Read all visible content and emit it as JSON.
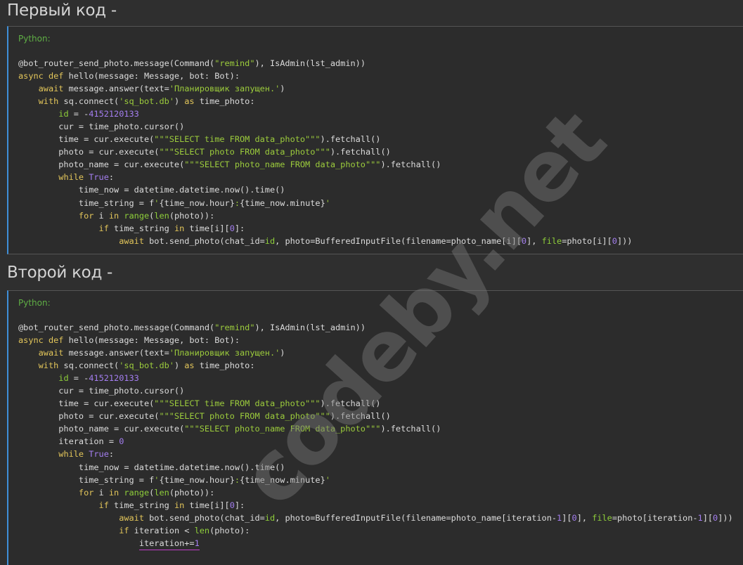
{
  "sections": [
    {
      "heading": "Первый код -",
      "language_label": "Python:",
      "code_lines": [
        [
          [
            "p",
            "@bot_router_send_photo.message(Command("
          ],
          [
            "str",
            "\"remind\""
          ],
          [
            "p",
            "), IsAdmin(lst_admin))"
          ]
        ],
        [
          [
            "kw",
            "async def "
          ],
          [
            "p",
            "hello(message: Message, bot: Bot):"
          ]
        ],
        [
          [
            "p",
            "    "
          ],
          [
            "kw",
            "await "
          ],
          [
            "p",
            "message.answer(text="
          ],
          [
            "str",
            "'Планировщик запущен.'"
          ],
          [
            "p",
            ")"
          ]
        ],
        [
          [
            "p",
            "    "
          ],
          [
            "kw",
            "with "
          ],
          [
            "p",
            "sq.connect("
          ],
          [
            "str",
            "'sq_bot.db'"
          ],
          [
            "p",
            ") "
          ],
          [
            "kw",
            "as "
          ],
          [
            "p",
            "time_photo:"
          ]
        ],
        [
          [
            "p",
            "        "
          ],
          [
            "bi",
            "id"
          ],
          [
            "p",
            " = -"
          ],
          [
            "num",
            "4152120133"
          ]
        ],
        [
          [
            "p",
            "        cur = time_photo.cursor()"
          ]
        ],
        [
          [
            "p",
            "        time = cur.execute("
          ],
          [
            "str",
            "\"\"\"SELECT time FROM data_photo\"\"\""
          ],
          [
            "p",
            ").fetchall()"
          ]
        ],
        [
          [
            "p",
            "        photo = cur.execute("
          ],
          [
            "str",
            "\"\"\"SELECT photo FROM data_photo\"\"\""
          ],
          [
            "p",
            ").fetchall()"
          ]
        ],
        [
          [
            "p",
            "        photo_name = cur.execute("
          ],
          [
            "str",
            "\"\"\"SELECT photo_name FROM data_photo\"\"\""
          ],
          [
            "p",
            ").fetchall()"
          ]
        ],
        [
          [
            "p",
            "        "
          ],
          [
            "kw",
            "while "
          ],
          [
            "num",
            "True"
          ],
          [
            "p",
            ":"
          ]
        ],
        [
          [
            "p",
            "            time_now = datetime.datetime.now().time()"
          ]
        ],
        [
          [
            "p",
            "            time_string = f"
          ],
          [
            "str",
            "'"
          ],
          [
            "p",
            "{time_now.hour}"
          ],
          [
            "str",
            ":"
          ],
          [
            "p",
            "{time_now.minute}"
          ],
          [
            "str",
            "'"
          ]
        ],
        [
          [
            "p",
            "            "
          ],
          [
            "kw",
            "for "
          ],
          [
            "p",
            "i "
          ],
          [
            "kw",
            "in "
          ],
          [
            "bi",
            "range"
          ],
          [
            "p",
            "("
          ],
          [
            "bi",
            "len"
          ],
          [
            "p",
            "(photo)):"
          ]
        ],
        [
          [
            "p",
            "                "
          ],
          [
            "kw",
            "if "
          ],
          [
            "p",
            "time_string "
          ],
          [
            "kw",
            "in "
          ],
          [
            "p",
            "time[i]["
          ],
          [
            "num",
            "0"
          ],
          [
            "p",
            "]:"
          ]
        ],
        [
          [
            "p",
            "                    "
          ],
          [
            "kw",
            "await "
          ],
          [
            "p",
            "bot.send_photo(chat_id="
          ],
          [
            "bi",
            "id"
          ],
          [
            "p",
            ", photo=BufferedInputFile(filename=photo_name[i]["
          ],
          [
            "num",
            "0"
          ],
          [
            "p",
            "], "
          ],
          [
            "bi",
            "file"
          ],
          [
            "p",
            "=photo[i]["
          ],
          [
            "num",
            "0"
          ],
          [
            "p",
            "]))"
          ]
        ]
      ]
    },
    {
      "heading": "Второй код -",
      "language_label": "Python:",
      "code_lines": [
        [
          [
            "p",
            "@bot_router_send_photo.message(Command("
          ],
          [
            "str",
            "\"remind\""
          ],
          [
            "p",
            "), IsAdmin(lst_admin))"
          ]
        ],
        [
          [
            "kw",
            "async def "
          ],
          [
            "p",
            "hello(message: Message, bot: Bot):"
          ]
        ],
        [
          [
            "p",
            "    "
          ],
          [
            "kw",
            "await "
          ],
          [
            "p",
            "message.answer(text="
          ],
          [
            "str",
            "'Планировщик запущен.'"
          ],
          [
            "p",
            ")"
          ]
        ],
        [
          [
            "p",
            "    "
          ],
          [
            "kw",
            "with "
          ],
          [
            "p",
            "sq.connect("
          ],
          [
            "str",
            "'sq_bot.db'"
          ],
          [
            "p",
            ") "
          ],
          [
            "kw",
            "as "
          ],
          [
            "p",
            "time_photo:"
          ]
        ],
        [
          [
            "p",
            "        "
          ],
          [
            "bi",
            "id"
          ],
          [
            "p",
            " = -"
          ],
          [
            "num",
            "4152120133"
          ]
        ],
        [
          [
            "p",
            "        cur = time_photo.cursor()"
          ]
        ],
        [
          [
            "p",
            "        time = cur.execute("
          ],
          [
            "str",
            "\"\"\"SELECT time FROM data_photo\"\"\""
          ],
          [
            "p",
            ").fetchall()"
          ]
        ],
        [
          [
            "p",
            "        photo = cur.execute("
          ],
          [
            "str",
            "\"\"\"SELECT photo FROM data_photo\"\"\""
          ],
          [
            "p",
            ").fetchall()"
          ]
        ],
        [
          [
            "p",
            "        photo_name = cur.execute("
          ],
          [
            "str",
            "\"\"\"SELECT photo_name FROM data_photo\"\"\""
          ],
          [
            "p",
            ").fetchall()"
          ]
        ],
        [
          [
            "p",
            "        iteration = "
          ],
          [
            "num",
            "0"
          ]
        ],
        [
          [
            "p",
            "        "
          ],
          [
            "kw",
            "while "
          ],
          [
            "num",
            "True"
          ],
          [
            "p",
            ":"
          ]
        ],
        [
          [
            "p",
            "            time_now = datetime.datetime.now().time()"
          ]
        ],
        [
          [
            "p",
            "            time_string = f"
          ],
          [
            "str",
            "'"
          ],
          [
            "p",
            "{time_now.hour}"
          ],
          [
            "str",
            ":"
          ],
          [
            "p",
            "{time_now.minute}"
          ],
          [
            "str",
            "'"
          ]
        ],
        [
          [
            "p",
            "            "
          ],
          [
            "kw",
            "for "
          ],
          [
            "p",
            "i "
          ],
          [
            "kw",
            "in "
          ],
          [
            "bi",
            "range"
          ],
          [
            "p",
            "("
          ],
          [
            "bi",
            "len"
          ],
          [
            "p",
            "(photo)):"
          ]
        ],
        [
          [
            "p",
            "                "
          ],
          [
            "kw",
            "if "
          ],
          [
            "p",
            "time_string "
          ],
          [
            "kw",
            "in "
          ],
          [
            "p",
            "time[i]["
          ],
          [
            "num",
            "0"
          ],
          [
            "p",
            "]:"
          ]
        ],
        [
          [
            "p",
            "                    "
          ],
          [
            "kw",
            "await "
          ],
          [
            "p",
            "bot.send_photo(chat_id="
          ],
          [
            "bi",
            "id"
          ],
          [
            "p",
            ", photo=BufferedInputFile(filename=photo_name[iteration-"
          ],
          [
            "num",
            "1"
          ],
          [
            "p",
            "]["
          ],
          [
            "num",
            "0"
          ],
          [
            "p",
            "], "
          ],
          [
            "bi",
            "file"
          ],
          [
            "p",
            "=photo[iteration-"
          ],
          [
            "num",
            "1"
          ],
          [
            "p",
            "]["
          ],
          [
            "num",
            "0"
          ],
          [
            "p",
            "]))"
          ]
        ],
        [
          [
            "p",
            "                    "
          ],
          [
            "kw",
            "if "
          ],
          [
            "p",
            "iteration < "
          ],
          [
            "bi",
            "len"
          ],
          [
            "p",
            "(photo):"
          ]
        ],
        [
          [
            "p",
            "                        "
          ],
          [
            "wavy",
            "iteration+="
          ],
          [
            "wavynum",
            "1"
          ]
        ]
      ]
    }
  ],
  "watermark": "codeby.net",
  "colors": {
    "accent_border": "#3f8fd8",
    "keyword": "#e2c55a",
    "builtin": "#8fcf3a",
    "string": "#9ccc3c",
    "number": "#a47ef0"
  }
}
